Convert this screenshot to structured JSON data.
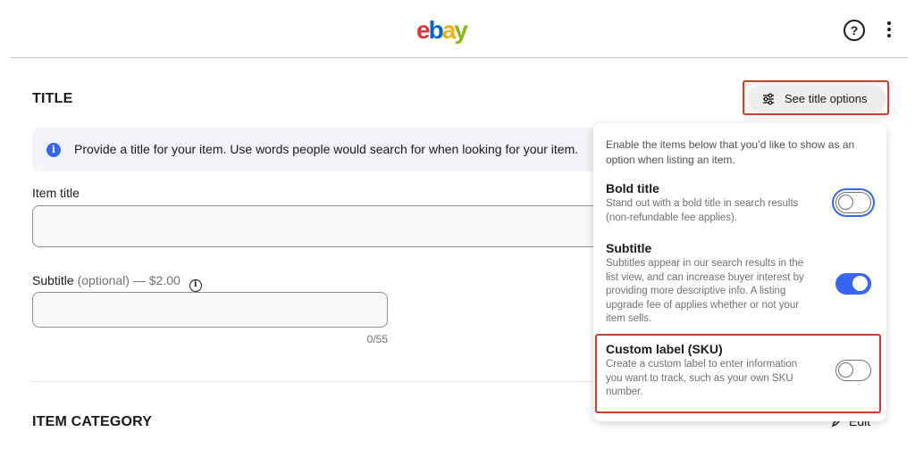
{
  "header": {
    "logo": {
      "e": "e",
      "b": "b",
      "a": "a",
      "y": "y"
    },
    "help_icon": "?",
    "more_icon": "vertical-ellipsis"
  },
  "title_section": {
    "heading": "TITLE",
    "options_button": "See title options",
    "info_text": "Provide a title for your item. Use words people would search for when looking for your item.",
    "item_title_label": "Item title",
    "item_title_value": "",
    "subtitle_label": "Subtitle",
    "subtitle_optional": "(optional) — $2.00",
    "subtitle_value": "",
    "subtitle_counter": "0/55"
  },
  "title_options_panel": {
    "intro": "Enable the items below that you’d like to show as an option when listing an item.",
    "options": [
      {
        "title": "Bold title",
        "description": "Stand out with a bold title in search results (non-refundable fee applies).",
        "enabled": false
      },
      {
        "title": "Subtitle",
        "description": "Subtitles appear in our search results in the list view, and can increase buyer interest by providing more descriptive info. A listing upgrade fee of applies whether or not your item sells.",
        "enabled": true
      },
      {
        "title": "Custom label (SKU)",
        "description": "Create a custom label to enter information you want to track, such as your own SKU number.",
        "enabled": false
      }
    ]
  },
  "category_section": {
    "heading": "ITEM CATEGORY",
    "edit_label": "Edit"
  },
  "colors": {
    "accent": "#3665f3",
    "highlight": "#d03b2d"
  }
}
